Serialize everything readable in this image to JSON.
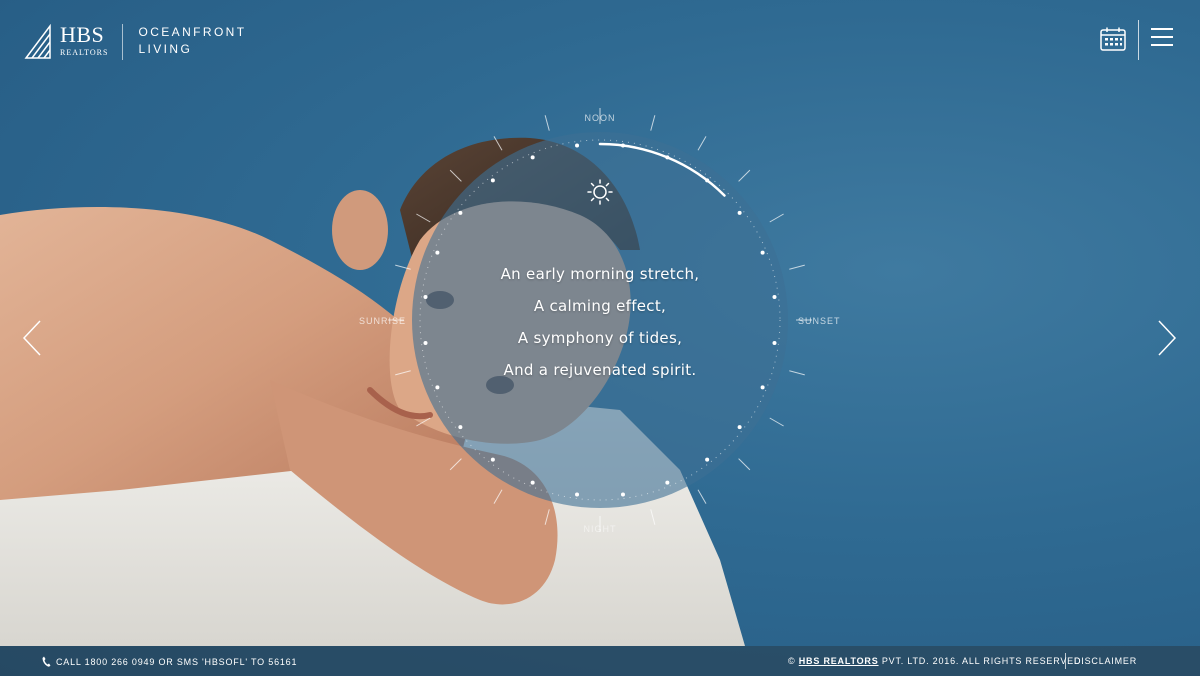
{
  "brand": {
    "logo_top": "HBS",
    "logo_bottom": "REALTORS",
    "tagline_line1": "OCEANFRONT",
    "tagline_line2": "LIVING"
  },
  "header": {
    "calendar_icon": "calendar-icon",
    "menu_icon": "hamburger-menu-icon"
  },
  "dial": {
    "label_top": "NOON",
    "label_right": "SUNSET",
    "label_left": "SUNRISE",
    "label_bottom": "NIGHT",
    "sun_icon": "sun-icon",
    "progress": 0.25
  },
  "poem": {
    "lines": [
      "An early morning stretch,",
      "A calming effect,",
      "A symphony of tides,",
      "And a rejuvenated spirit."
    ]
  },
  "nav": {
    "prev_icon": "chevron-left-icon",
    "next_icon": "chevron-right-icon"
  },
  "footer": {
    "phone_icon": "phone-icon",
    "phone_text": "CALL 1800 266 0949 OR SMS 'HBSOFL' TO 56161",
    "copy_prefix": "©",
    "copy_link": "HBS REALTORS",
    "copy_suffix": "PVT. LTD. 2016. ALL RIGHTS RESERVED.",
    "disclaimer": "DISCLAIMER"
  },
  "colors": {
    "sea": "#2f6a92",
    "skin": "#d6a184",
    "towel": "#ecebe6",
    "dial_fill": "#3e6f95"
  }
}
